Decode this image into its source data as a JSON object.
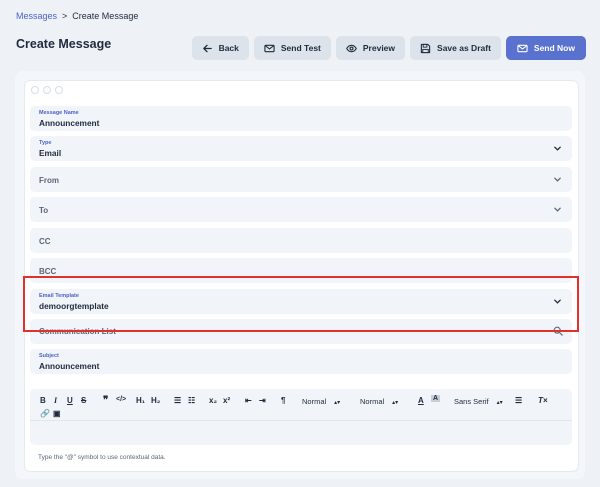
{
  "breadcrumb": {
    "parent": "Messages",
    "separator": ">",
    "current": "Create Message"
  },
  "page_title": "Create Message",
  "toolbar": {
    "back": "Back",
    "send_test": "Send Test",
    "preview": "Preview",
    "save_draft": "Save as Draft",
    "send_now": "Send Now"
  },
  "form": {
    "message_name": {
      "label": "Message Name",
      "value": "Announcement"
    },
    "type": {
      "label": "Type",
      "value": "Email"
    },
    "from": {
      "placeholder": "From"
    },
    "to": {
      "placeholder": "To"
    },
    "cc": {
      "placeholder": "CC"
    },
    "bcc": {
      "placeholder": "BCC"
    },
    "email_template": {
      "label": "Email Template",
      "value": "demoorgtemplate"
    },
    "communication_list": {
      "placeholder": "Communication List"
    },
    "subject": {
      "label": "Subject",
      "value": "Announcement"
    }
  },
  "editor": {
    "heading_select": "Normal",
    "size_select": "Normal",
    "font_select": "Sans Serif",
    "h1": "H₁",
    "h2": "H₂",
    "sub": "x₂",
    "sup": "x²",
    "hint": "Type the \"@\" symbol to use contextual data."
  },
  "colors": {
    "accent": "#5a72cf",
    "highlight": "#e3302a",
    "link": "#4a63c9"
  }
}
